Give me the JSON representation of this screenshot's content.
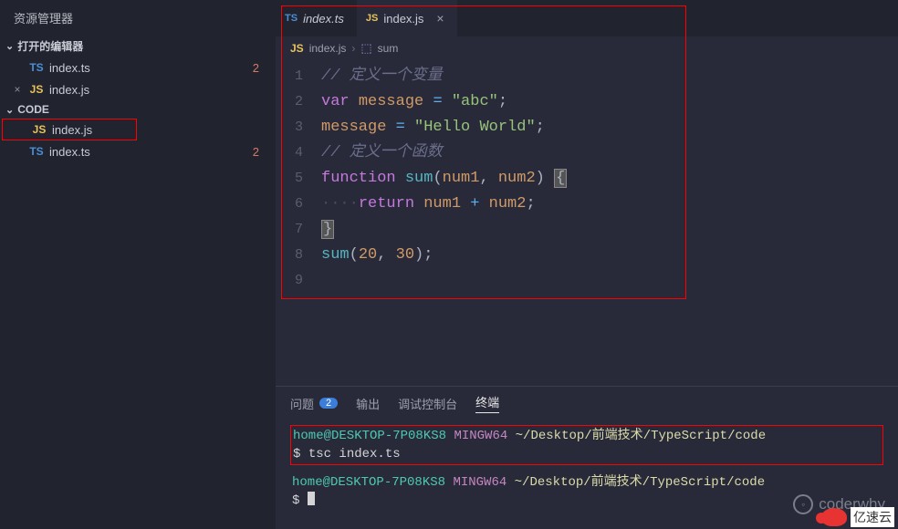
{
  "sidebar": {
    "title": "资源管理器",
    "open_editors_label": "打开的编辑器",
    "open_editors": [
      {
        "icon": "TS",
        "label": "index.ts",
        "badge": "2",
        "pre": ""
      },
      {
        "icon": "JS",
        "label": "index.js",
        "badge": "",
        "pre": "×"
      }
    ],
    "workspace_label": "CODE",
    "files": [
      {
        "icon": "JS",
        "label": "index.js",
        "badge": ""
      },
      {
        "icon": "TS",
        "label": "index.ts",
        "badge": "2"
      }
    ]
  },
  "tabs": [
    {
      "icon": "TS",
      "label": "index.ts",
      "active": false
    },
    {
      "icon": "JS",
      "label": "index.js",
      "active": true,
      "close": "×"
    }
  ],
  "breadcrumb": {
    "icon": "JS",
    "file": "index.js",
    "symbol": "sum"
  },
  "code": {
    "lines": [
      "1",
      "2",
      "3",
      "4",
      "5",
      "6",
      "7",
      "8",
      "9"
    ],
    "l1_comment": "// 定义一个变量",
    "l2_kw": "var",
    "l2_var": "message",
    "l2_op": "=",
    "l2_str": "\"abc\"",
    "l2_semi": ";",
    "l3_var": "message",
    "l3_op": "=",
    "l3_str": "\"Hello World\"",
    "l3_semi": ";",
    "l4_comment": "// 定义一个函数",
    "l5_kw": "function",
    "l5_fn": "sum",
    "l5_open": "(",
    "l5_a1": "num1",
    "l5_comma": ", ",
    "l5_a2": "num2",
    "l5_close": ") ",
    "l5_brace": "{",
    "l6_dots": "····",
    "l6_kw": "return",
    "l6_a1": "num1",
    "l6_op": "+",
    "l6_a2": "num2",
    "l6_semi": ";",
    "l7_brace": "}",
    "l8_fn": "sum",
    "l8_open": "(",
    "l8_n1": "20",
    "l8_comma": ", ",
    "l8_n2": "30",
    "l8_close": ")",
    "l8_semi": ";"
  },
  "terminal": {
    "tabs": {
      "problems": "问题",
      "problems_count": "2",
      "output": "输出",
      "debug": "调试控制台",
      "terminal": "终端"
    },
    "prompt_user": "home@DESKTOP-7P08KS8",
    "prompt_env": "MINGW64",
    "prompt_path": "~/Desktop/前端技术/TypeScript/code",
    "cmd1": "tsc index.ts",
    "dollar": "$"
  },
  "watermark": "coderwhy",
  "brand": "亿速云"
}
